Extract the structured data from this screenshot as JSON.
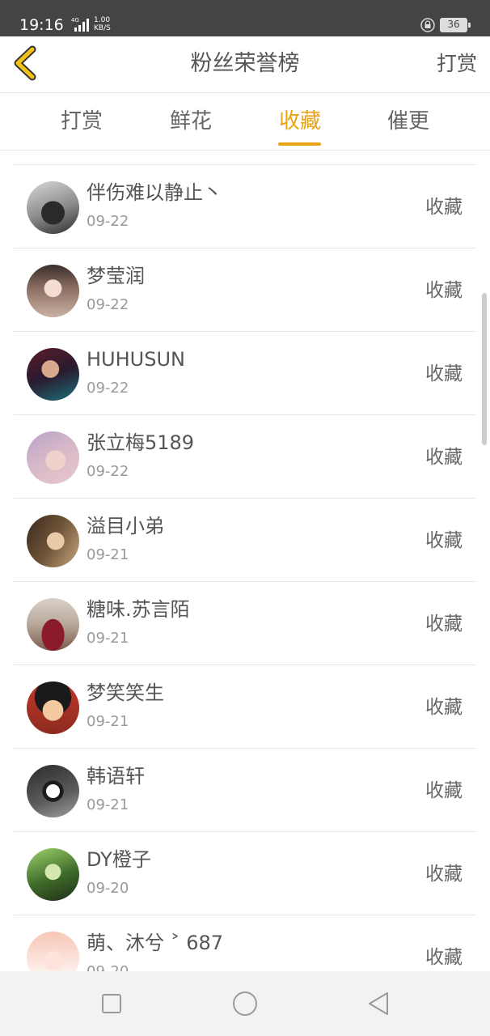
{
  "status_bar": {
    "time": "19:16",
    "network": "4G",
    "speed_value": "1.00",
    "speed_unit": "KB/S",
    "battery": "36"
  },
  "header": {
    "title": "粉丝荣誉榜",
    "action_label": "打赏"
  },
  "tabs": [
    {
      "label": "打赏",
      "active": false
    },
    {
      "label": "鲜花",
      "active": false
    },
    {
      "label": "收藏",
      "active": true
    },
    {
      "label": "催更",
      "active": false
    }
  ],
  "accent_color": "#e8a317",
  "list": {
    "rows": [
      {
        "name": "伴伤难以静止丶",
        "date": "09-22",
        "action": "收藏"
      },
      {
        "name": "梦莹润",
        "date": "09-22",
        "action": "收藏"
      },
      {
        "name": "HUHUSUN",
        "date": "09-22",
        "action": "收藏"
      },
      {
        "name": "张立梅5189",
        "date": "09-22",
        "action": "收藏"
      },
      {
        "name": "溢目小弟",
        "date": "09-21",
        "action": "收藏"
      },
      {
        "name": "糖味.苏言陌",
        "date": "09-21",
        "action": "收藏"
      },
      {
        "name": "梦笑笑生",
        "date": "09-21",
        "action": "收藏"
      },
      {
        "name": "韩语轩",
        "date": "09-21",
        "action": "收藏"
      },
      {
        "name": "DY橙子",
        "date": "09-20",
        "action": "收藏"
      },
      {
        "name": "萌、沐兮 ˃ 687",
        "date": "09-20",
        "action": "收藏"
      }
    ]
  },
  "nav_bar": {
    "icons": [
      "square-icon",
      "circle-icon",
      "triangle-back-icon"
    ]
  }
}
